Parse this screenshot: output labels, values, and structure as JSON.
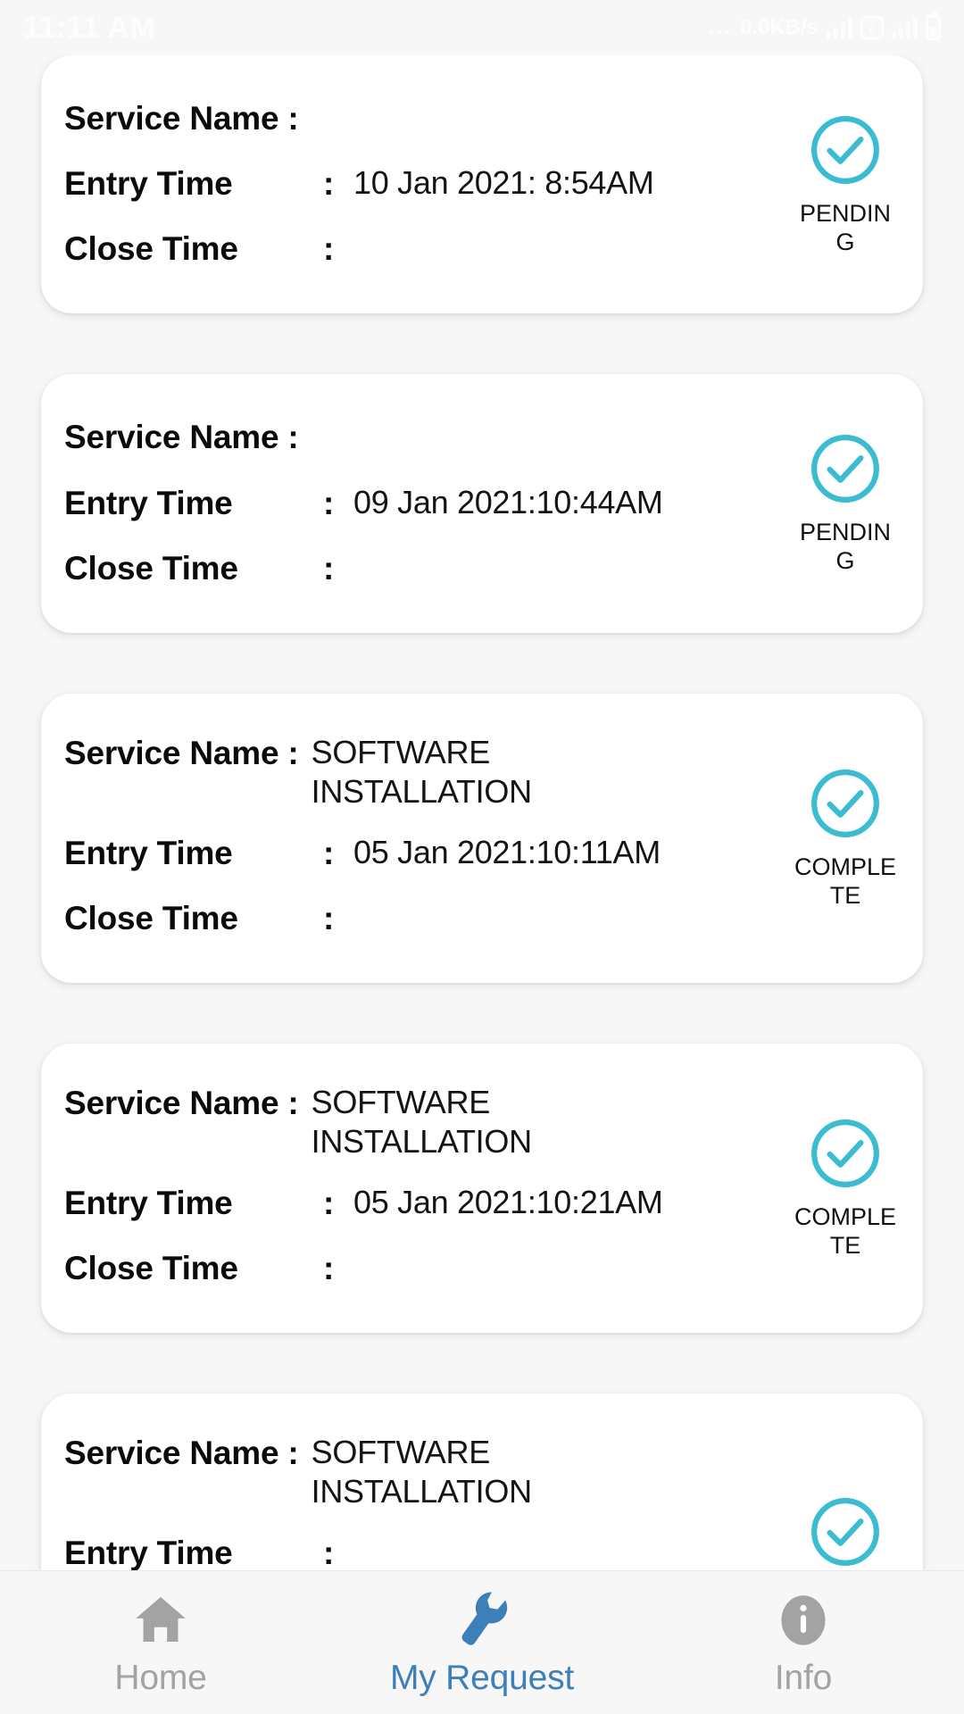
{
  "statusbar": {
    "time": "11:11 AM",
    "network_speed": "0.0KB/s",
    "dots": "...",
    "sim_label": "2",
    "icons": [
      "signal-bars-icon",
      "sim-card-icon",
      "wifi-signal-icon",
      "battery-icon"
    ]
  },
  "screen": {
    "title": "My Request"
  },
  "labels": {
    "service_name": "Service Name",
    "entry_time": "Entry Time",
    "close_time": "Close Time",
    "colon": ":"
  },
  "colors": {
    "accent_teal": "#3BBCD0",
    "accent_blue": "#3D7FB8",
    "inactive_gray": "#A3A3A3",
    "card_bg": "#FFFFFF",
    "page_bg": "#F7F7F7"
  },
  "requests": [
    {
      "service_name": "",
      "entry_time": "10 Jan 2021: 8:54AM",
      "close_time": "",
      "status": "PENDING",
      "status_icon": "check-circle-icon"
    },
    {
      "service_name": "",
      "entry_time": "09 Jan 2021:10:44AM",
      "close_time": "",
      "status": "PENDING",
      "status_icon": "check-circle-icon"
    },
    {
      "service_name": "SOFTWARE INSTALLATION",
      "entry_time": "05 Jan 2021:10:11AM",
      "close_time": "",
      "status": "COMPLETE",
      "status_icon": "check-circle-icon"
    },
    {
      "service_name": "SOFTWARE INSTALLATION",
      "entry_time": "05 Jan 2021:10:21AM",
      "close_time": "",
      "status": "COMPLETE",
      "status_icon": "check-circle-icon"
    },
    {
      "service_name": "SOFTWARE INSTALLATION",
      "entry_time": "",
      "close_time": "",
      "status": "",
      "status_icon": "check-circle-icon"
    }
  ],
  "bottom_nav": [
    {
      "label": "Home",
      "icon": "home-icon",
      "active": false
    },
    {
      "label": "My Request",
      "icon": "wrench-icon",
      "active": true
    },
    {
      "label": "Info",
      "icon": "info-icon",
      "active": false
    }
  ]
}
